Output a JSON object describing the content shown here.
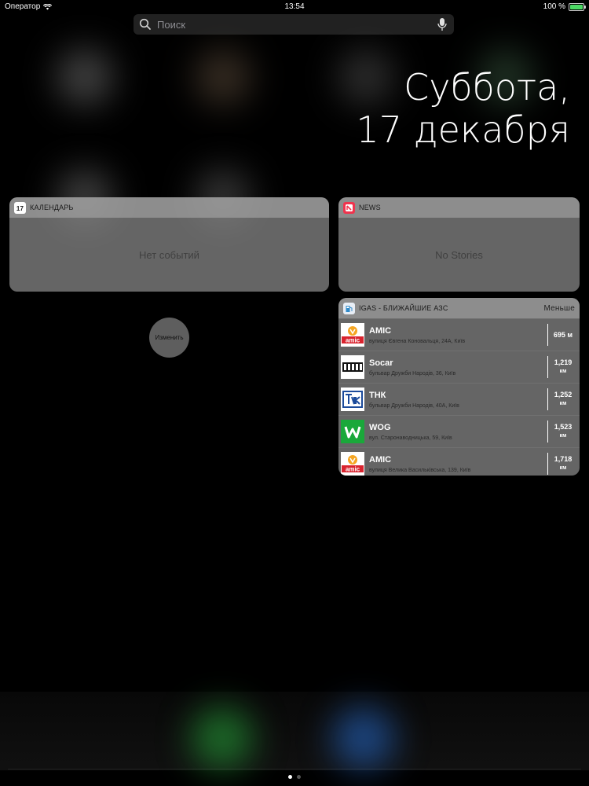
{
  "status_bar": {
    "carrier": "Оператор",
    "time": "13:54",
    "battery": "100 %"
  },
  "search": {
    "placeholder": "Поиск"
  },
  "date": {
    "line1": "Суббота,",
    "line2": "17 декабря"
  },
  "calendar_widget": {
    "icon_day": "17",
    "title": "КАЛЕНДАРЬ",
    "empty_text": "Нет событий"
  },
  "news_widget": {
    "title": "NEWS",
    "empty_text": "No Stories"
  },
  "igas_widget": {
    "title": "IGAS - БЛИЖАЙШИЕ АЗС",
    "toggle_label": "Меньше",
    "stations": [
      {
        "name": "AMIC",
        "address": "вулиця Євгена Коновальця, 24А, Київ",
        "distance": "695 м",
        "unit": "",
        "logo": "amic"
      },
      {
        "name": "Socar",
        "address": "бульвар Дружби Народів, 36, Київ",
        "distance": "1,219",
        "unit": "км",
        "logo": "socar"
      },
      {
        "name": "ТНК",
        "address": "бульвар Дружби Народів, 40А, Київ",
        "distance": "1,252",
        "unit": "км",
        "logo": "tnk"
      },
      {
        "name": "WOG",
        "address": "вул. Старонаводницька, 59, Київ",
        "distance": "1,523",
        "unit": "км",
        "logo": "wog"
      },
      {
        "name": "AMIC",
        "address": "вулиця Велика Васильківська, 139, Київ",
        "distance": "1,718",
        "unit": "км",
        "logo": "amic"
      }
    ]
  },
  "edit_button": {
    "label": "Изменить"
  },
  "page_indicator": {
    "count": 2,
    "active": 0
  },
  "colors": {
    "battery": "#4cd964",
    "news_icon": "#f0344e",
    "wog_green": "#1aa83a",
    "amic_red": "#d9232e",
    "tnk_blue": "#1c4b9b"
  }
}
